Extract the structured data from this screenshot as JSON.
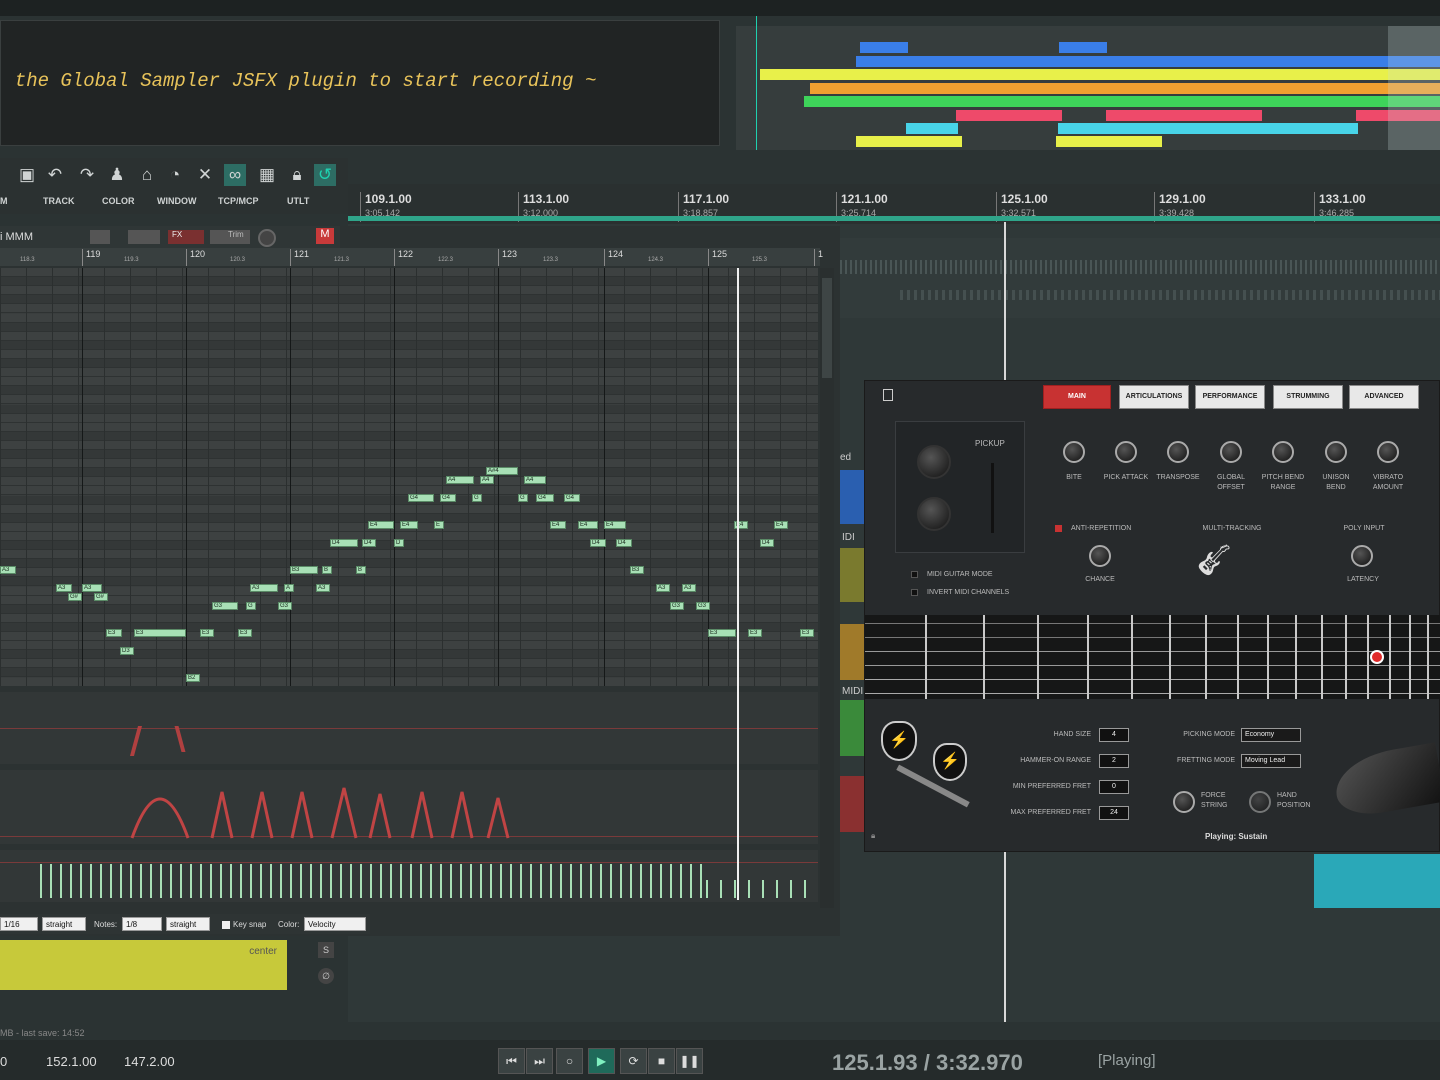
{
  "console": {
    "text": ": the Global Sampler JSFX plugin to start recording ~"
  },
  "overview": {
    "colors": {
      "blue": "#3a7ee8",
      "yellow": "#e8f04a",
      "orange": "#f0a030",
      "green": "#3ed45a",
      "red": "#ee4a6a",
      "cyan": "#48d4e8"
    }
  },
  "toolbar": {
    "labels": [
      "M",
      "TRACK",
      "COLOR",
      "WINDOW",
      "TCP/MCP",
      "UTLT"
    ],
    "icons": [
      "undo-icon",
      "redo-icon",
      "metronome-icon",
      "lock-icon",
      "loop-icon"
    ]
  },
  "ruler": {
    "marks": [
      {
        "bar": "109.1.00",
        "time": "3:05.142"
      },
      {
        "bar": "113.1.00",
        "time": "3:12.000"
      },
      {
        "bar": "117.1.00",
        "time": "3:18.857"
      },
      {
        "bar": "121.1.00",
        "time": "3:25.714"
      },
      {
        "bar": "125.1.00",
        "time": "3:32.571"
      },
      {
        "bar": "129.1.00",
        "time": "3:39.428"
      },
      {
        "bar": "133.1.00",
        "time": "3:46.285"
      }
    ]
  },
  "midi": {
    "track_name": "i MMM",
    "fx_label": "FX",
    "trim_label": "Trim",
    "m_label": "M",
    "ruler": {
      "bars": [
        "119",
        "120",
        "121",
        "122",
        "123",
        "124",
        "125",
        "1"
      ],
      "subs": [
        "118.3",
        "119.3",
        "120.3",
        "121.3",
        "122.3",
        "123.3",
        "124.3",
        "125.3"
      ]
    },
    "notes": [
      {
        "n": "A4"
      },
      {
        "n": "A4"
      },
      {
        "n": "A#4"
      },
      {
        "n": "A4"
      },
      {
        "n": "G4"
      },
      {
        "n": "G4"
      },
      {
        "n": "G"
      },
      {
        "n": "G"
      },
      {
        "n": "G4"
      },
      {
        "n": "G4"
      },
      {
        "n": "E4"
      },
      {
        "n": "E4"
      },
      {
        "n": "E"
      },
      {
        "n": "E4"
      },
      {
        "n": "E4"
      },
      {
        "n": "E4"
      },
      {
        "n": "E4"
      },
      {
        "n": "E4"
      },
      {
        "n": "D4"
      },
      {
        "n": "D4"
      },
      {
        "n": "D"
      },
      {
        "n": "D4"
      },
      {
        "n": "D4"
      },
      {
        "n": "D4"
      },
      {
        "n": "B3"
      },
      {
        "n": "B"
      },
      {
        "n": "B"
      },
      {
        "n": "B3"
      },
      {
        "n": "A3"
      },
      {
        "n": "A3"
      },
      {
        "n": "A3"
      },
      {
        "n": "A"
      },
      {
        "n": "A3"
      },
      {
        "n": "A3"
      },
      {
        "n": "A3"
      },
      {
        "n": "A3"
      },
      {
        "n": "G#"
      },
      {
        "n": "G#"
      },
      {
        "n": "G3"
      },
      {
        "n": "G"
      },
      {
        "n": "G3"
      },
      {
        "n": "G3"
      },
      {
        "n": "G3"
      },
      {
        "n": "E3"
      },
      {
        "n": "E3"
      },
      {
        "n": "E3"
      },
      {
        "n": "E3"
      },
      {
        "n": "E3"
      },
      {
        "n": "E3"
      },
      {
        "n": "E3"
      },
      {
        "n": "D3"
      },
      {
        "n": "B2"
      }
    ],
    "bottom": {
      "grid_val": "1/16",
      "grid_mode": "straight",
      "notes_label": "Notes:",
      "notes_val": "1/8",
      "notes_mode": "straight",
      "key_snap": "Key snap",
      "color_label": "Color:",
      "color_val": "Velocity"
    }
  },
  "track_item": {
    "label": "center"
  },
  "side_labels": {
    "ed": "ed",
    "midi1": "IDI",
    "midi2": "MIDI"
  },
  "status": {
    "last_save": "MB - last save: 14:52"
  },
  "transport": {
    "left_a": "0",
    "left_b": "152.1.00",
    "left_c": "147.2.00",
    "position": "125.1.93 / 3:32.970",
    "state": "[Playing]"
  },
  "plugin": {
    "tabs": [
      "MAIN",
      "ARTICULATIONS",
      "PERFORMANCE",
      "STRUMMING",
      "ADVANCED"
    ],
    "pickup": "PICKUP",
    "knobs": [
      {
        "label": "BITE"
      },
      {
        "label": "PICK ATTACK"
      },
      {
        "label": "TRANSPOSE"
      },
      {
        "label": "GLOBAL OFFSET"
      },
      {
        "label": "PITCH BEND RANGE"
      },
      {
        "label": "UNISON BEND"
      },
      {
        "label": "VIBRATO AMOUNT"
      }
    ],
    "midi_guitar_mode": "MIDI GUITAR MODE",
    "invert_midi": "INVERT MIDI CHANNELS",
    "anti_rep": "ANTI-REPETITION",
    "chance": "CHANCE",
    "multi_tracking": "MULTI-TRACKING",
    "poly_input": "POLY INPUT",
    "latency": "LATENCY",
    "fields": [
      {
        "label": "HAND SIZE",
        "value": "4"
      },
      {
        "label": "HAMMER-ON RANGE",
        "value": "2"
      },
      {
        "label": "MIN PREFERRED FRET",
        "value": "0"
      },
      {
        "label": "MAX PREFERRED FRET",
        "value": "24"
      }
    ],
    "picking_mode": {
      "label": "PICKING MODE",
      "value": "Economy"
    },
    "fretting_mode": {
      "label": "FRETTING MODE",
      "value": "Moving Lead"
    },
    "force_string": "FORCE STRING",
    "hand_position": "HAND POSITION",
    "status": "Playing: Sustain"
  }
}
